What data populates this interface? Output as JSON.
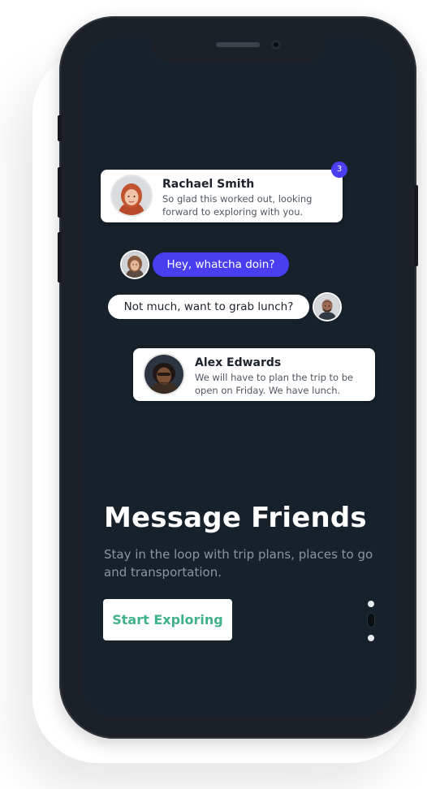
{
  "colors": {
    "screen_background": "#16212b",
    "accent": "#4a3ff0",
    "cta_text": "#3fb28d",
    "card_background": "#ffffff"
  },
  "messages": [
    {
      "name": "Rachael Smith",
      "text": "So glad this worked out, looking forward to exploring with you.",
      "unread_badge": "3"
    },
    {
      "name": "Alex Edwards",
      "text": "We will have to plan the trip to be open on Friday. We have lunch."
    }
  ],
  "chat": {
    "incoming": "Hey, whatcha doin?",
    "outgoing": "Not much, want to grab lunch?"
  },
  "onboarding": {
    "title": "Message Friends",
    "subtitle": "Stay in the loop with trip plans, places to go and transportation.",
    "cta_label": "Start Exploring",
    "page_count": 3,
    "active_page": 2
  },
  "icons": [
    "avatar-rachael",
    "avatar-alex",
    "avatar-small-incoming",
    "avatar-small-outgoing"
  ]
}
